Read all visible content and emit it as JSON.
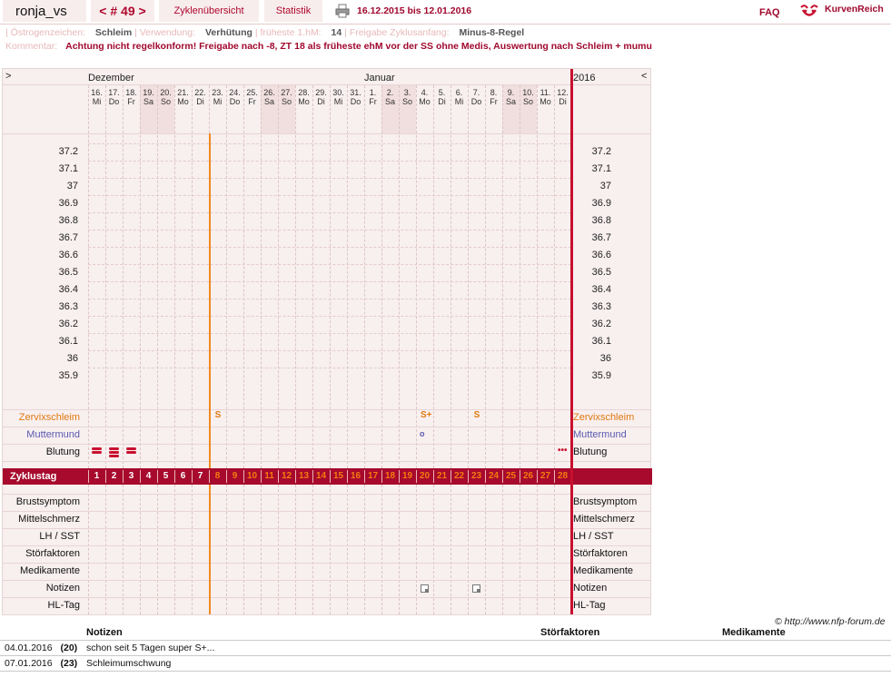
{
  "header": {
    "username": "ronja_vs",
    "cycle_nav": "< # 49 >",
    "tabs": [
      "Zyklenübersicht",
      "Statistik"
    ],
    "date_range": "16.12.2015 bis 12.01.2016",
    "faq": "FAQ",
    "brand": "KurvenReich",
    "icons": [
      "printer-icon",
      "kurvenreich-logo-icon"
    ]
  },
  "meta": {
    "line1": [
      {
        "label": "Östrogenzeichen:",
        "value": "Schleim"
      },
      {
        "label": "Verwendung:",
        "value": "Verhütung"
      },
      {
        "label": "früheste 1.hM:",
        "value": "14"
      },
      {
        "label": "Freigabe Zyklusanfang:",
        "value": "Minus-8-Regel"
      }
    ],
    "comment_label": "Kommentar:",
    "comment": "Achtung nicht regelkonform! Freigabe nach -8, ZT 18 als früheste ehM vor der SS ohne Medis, Auswertung nach Schleim + mumu"
  },
  "chart": {
    "nav_prev": ">",
    "nav_next": "<",
    "month1": "Dezember",
    "month2": "Januar",
    "year": "2016",
    "days": [
      {
        "d": "16.",
        "w": "Mi",
        "we": false
      },
      {
        "d": "17.",
        "w": "Do",
        "we": false
      },
      {
        "d": "18.",
        "w": "Fr",
        "we": false
      },
      {
        "d": "19.",
        "w": "Sa",
        "we": true
      },
      {
        "d": "20.",
        "w": "So",
        "we": true
      },
      {
        "d": "21.",
        "w": "Mo",
        "we": false
      },
      {
        "d": "22.",
        "w": "Di",
        "we": false
      },
      {
        "d": "23.",
        "w": "Mi",
        "we": false
      },
      {
        "d": "24.",
        "w": "Do",
        "we": false
      },
      {
        "d": "25.",
        "w": "Fr",
        "we": false
      },
      {
        "d": "26.",
        "w": "Sa",
        "we": true
      },
      {
        "d": "27.",
        "w": "So",
        "we": true
      },
      {
        "d": "28.",
        "w": "Mo",
        "we": false
      },
      {
        "d": "29.",
        "w": "Di",
        "we": false
      },
      {
        "d": "30.",
        "w": "Mi",
        "we": false
      },
      {
        "d": "31.",
        "w": "Do",
        "we": false
      },
      {
        "d": "1.",
        "w": "Fr",
        "we": false
      },
      {
        "d": "2.",
        "w": "Sa",
        "we": true
      },
      {
        "d": "3.",
        "w": "So",
        "we": true
      },
      {
        "d": "4.",
        "w": "Mo",
        "we": false
      },
      {
        "d": "5.",
        "w": "Di",
        "we": false
      },
      {
        "d": "6.",
        "w": "Mi",
        "we": false
      },
      {
        "d": "7.",
        "w": "Do",
        "we": false
      },
      {
        "d": "8.",
        "w": "Fr",
        "we": false
      },
      {
        "d": "9.",
        "w": "Sa",
        "we": true
      },
      {
        "d": "10.",
        "w": "So",
        "we": true
      },
      {
        "d": "11.",
        "w": "Mo",
        "we": false
      },
      {
        "d": "12.",
        "w": "Di",
        "we": false
      }
    ],
    "temps": [
      "37.2",
      "37.1",
      "37",
      "36.9",
      "36.8",
      "36.7",
      "36.6",
      "36.5",
      "36.4",
      "36.3",
      "36.2",
      "36.1",
      "36",
      "35.9"
    ],
    "rows_top": [
      "Zervixschleim",
      "Muttermund",
      "Blutung"
    ],
    "zyklustag_label": "Zyklustag",
    "zyklustage": [
      "1",
      "2",
      "3",
      "4",
      "5",
      "6",
      "7",
      "8",
      "9",
      "10",
      "11",
      "12",
      "13",
      "14",
      "15",
      "16",
      "17",
      "18",
      "19",
      "20",
      "21",
      "22",
      "23",
      "24",
      "25",
      "26",
      "27",
      "28"
    ],
    "release_after_day": 7,
    "rows_bottom": [
      "Brustsymptom",
      "Mittelschmerz",
      "LH / SST",
      "Störfaktoren",
      "Medikamente",
      "Notizen",
      "HL-Tag"
    ],
    "zervix_marks": [
      {
        "day": 8,
        "symbol": "S"
      },
      {
        "day": 20,
        "symbol": "S+"
      },
      {
        "day": 23,
        "symbol": "S"
      }
    ],
    "muttermund_marks": [
      {
        "day": 20,
        "symbol": "o"
      }
    ],
    "blutung_marks": [
      {
        "day": 1,
        "level": 2
      },
      {
        "day": 2,
        "level": 3
      },
      {
        "day": 3,
        "level": 2
      },
      {
        "day": 28,
        "level": 1
      }
    ],
    "notiz_marks": [
      20,
      23
    ],
    "colors": {
      "accent": "#a70a2c",
      "orange": "#e07a10",
      "mumu": "#5a5ab0"
    }
  },
  "copyright": "© http://www.nfp-forum.de",
  "notes_table": {
    "headers": [
      "Notizen",
      "Störfaktoren",
      "Medikamente"
    ],
    "rows": [
      {
        "date": "04.01.2016",
        "zt": "(20)",
        "text": "schon seit 5 Tagen super S+..."
      },
      {
        "date": "07.01.2016",
        "zt": "(23)",
        "text": "Schleimumschwung"
      }
    ]
  }
}
